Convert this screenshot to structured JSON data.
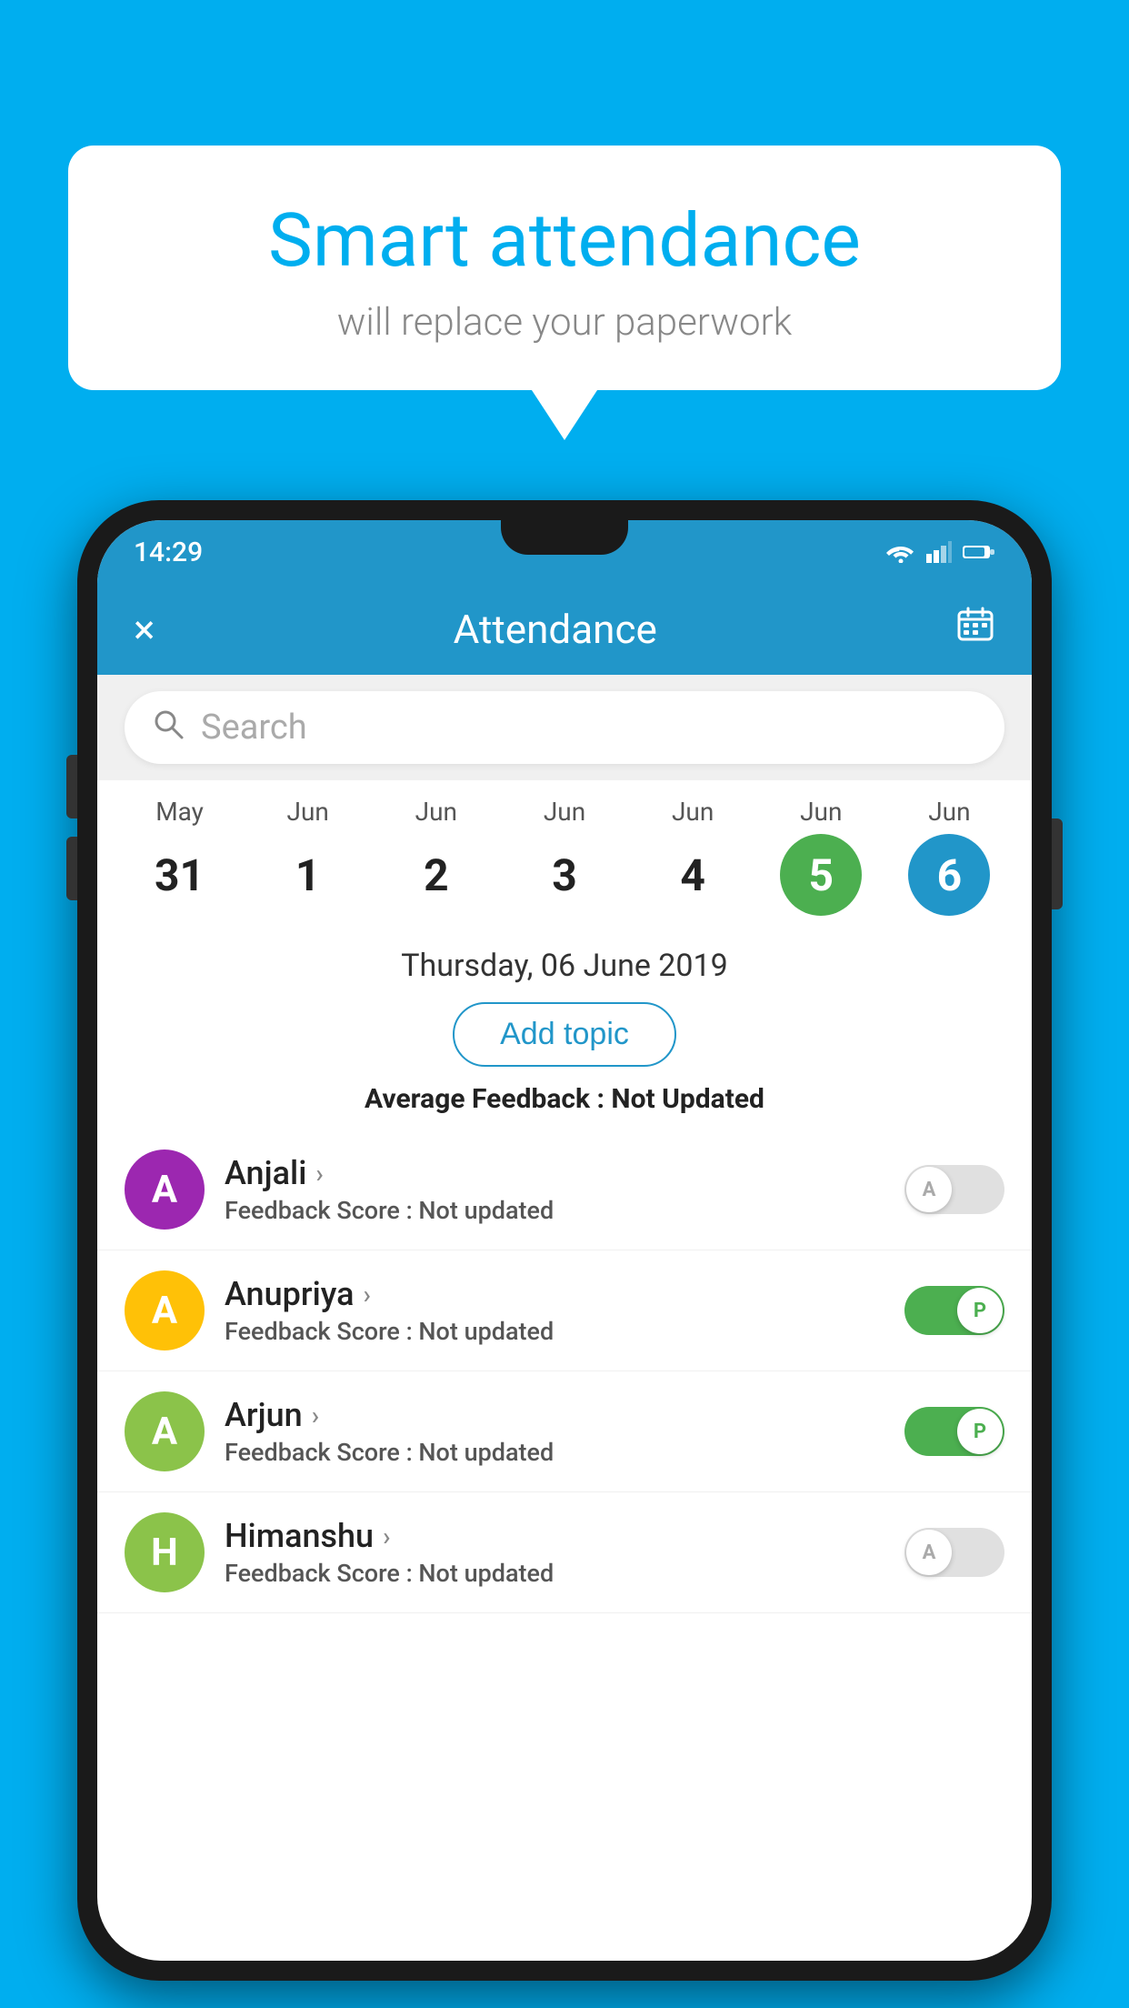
{
  "background_color": "#00AEEF",
  "speech_bubble": {
    "title": "Smart attendance",
    "subtitle": "will replace your paperwork"
  },
  "status_bar": {
    "time": "14:29"
  },
  "app_bar": {
    "title": "Attendance",
    "close_label": "×",
    "calendar_label": "📅"
  },
  "search": {
    "placeholder": "Search"
  },
  "calendar": {
    "months": [
      "May",
      "Jun",
      "Jun",
      "Jun",
      "Jun",
      "Jun",
      "Jun"
    ],
    "dates": [
      {
        "date": "31",
        "state": "normal"
      },
      {
        "date": "1",
        "state": "normal"
      },
      {
        "date": "2",
        "state": "normal"
      },
      {
        "date": "3",
        "state": "normal"
      },
      {
        "date": "4",
        "state": "normal"
      },
      {
        "date": "5",
        "state": "today"
      },
      {
        "date": "6",
        "state": "selected"
      }
    ]
  },
  "selected_date": "Thursday, 06 June 2019",
  "add_topic_label": "Add topic",
  "avg_feedback": {
    "label": "Average Feedback : ",
    "value": "Not Updated"
  },
  "students": [
    {
      "name": "Anjali",
      "avatar_letter": "A",
      "avatar_color": "#9C27B0",
      "feedback_label": "Feedback Score : ",
      "feedback_value": "Not updated",
      "toggle": "off",
      "toggle_letter": "A"
    },
    {
      "name": "Anupriya",
      "avatar_letter": "A",
      "avatar_color": "#FFC107",
      "feedback_label": "Feedback Score : ",
      "feedback_value": "Not updated",
      "toggle": "on",
      "toggle_letter": "P"
    },
    {
      "name": "Arjun",
      "avatar_letter": "A",
      "avatar_color": "#8BC34A",
      "feedback_label": "Feedback Score : ",
      "feedback_value": "Not updated",
      "toggle": "on",
      "toggle_letter": "P"
    },
    {
      "name": "Himanshu",
      "avatar_letter": "H",
      "avatar_color": "#8BC34A",
      "feedback_label": "Feedback Score : ",
      "feedback_value": "Not updated",
      "toggle": "off",
      "toggle_letter": "A"
    }
  ]
}
